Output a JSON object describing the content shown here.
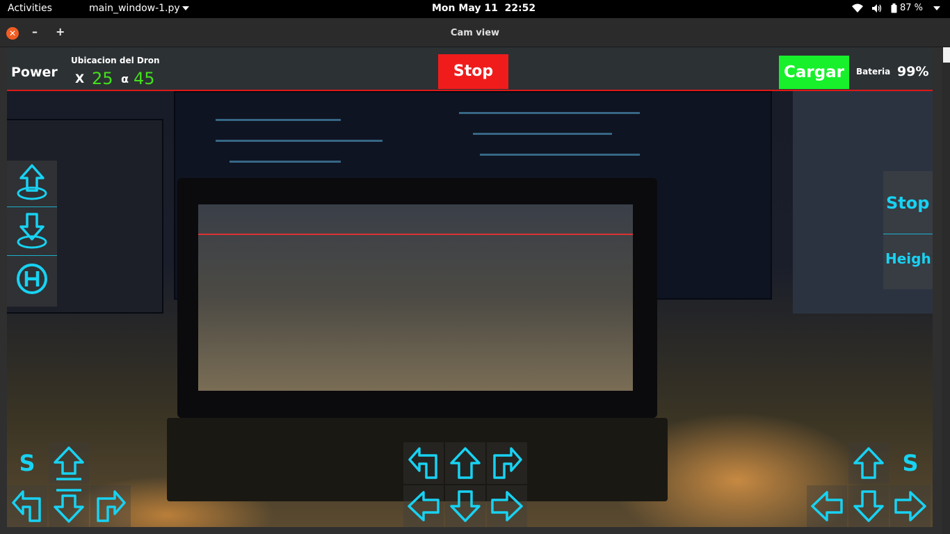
{
  "topbar": {
    "activities": "Activities",
    "app_menu": "main_window-1.py",
    "clock_date": "Mon May 11",
    "clock_time": "22:52",
    "battery": "87 %"
  },
  "window": {
    "title": "Cam view"
  },
  "hud": {
    "power_label": "Power",
    "location_title": "Ubicacion del Dron",
    "x_label": "X",
    "x_value": "25",
    "alpha_label": "α",
    "alpha_value": "45",
    "stop_label": "Stop",
    "cargar_label": "Cargar",
    "battery_label": "Bateria",
    "battery_value": "99%"
  },
  "controls": {
    "left_s": "S",
    "right_s": "S",
    "right_panel_stop": "Stop",
    "right_panel_height": "Heigh",
    "accent_color": "#18d2f2"
  },
  "icons": {
    "takeoff": "takeoff-icon",
    "land": "land-icon",
    "hover": "helipad-icon",
    "arrow_up": "arrow-up-icon",
    "arrow_down": "arrow-down-icon",
    "arrow_left": "arrow-left-icon",
    "arrow_right": "arrow-right-icon",
    "turn_left": "turn-left-icon",
    "turn_right": "turn-right-icon"
  }
}
